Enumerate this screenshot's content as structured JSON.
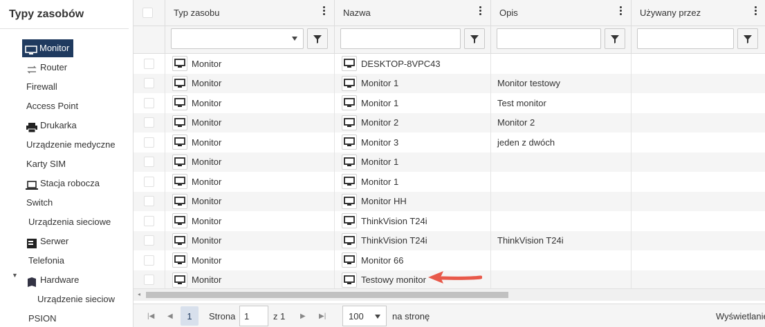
{
  "sidebar": {
    "title": "Typy zasobów",
    "items": [
      {
        "label": "Monitor",
        "icon": "monitor-icon"
      },
      {
        "label": "Router",
        "icon": "router-icon"
      },
      {
        "label": "Firewall",
        "icon": ""
      },
      {
        "label": "Access Point",
        "icon": ""
      },
      {
        "label": "Drukarka",
        "icon": "printer-icon"
      },
      {
        "label": "Urządzenie medyczne",
        "icon": ""
      },
      {
        "label": "Karty SIM",
        "icon": ""
      },
      {
        "label": "Stacja robocza",
        "icon": "laptop-icon"
      },
      {
        "label": "Switch",
        "icon": ""
      },
      {
        "label": "Urządzenia sieciowe",
        "icon": ""
      },
      {
        "label": "Serwer",
        "icon": "server-icon"
      },
      {
        "label": "Telefonia",
        "icon": ""
      },
      {
        "label": "Hardware",
        "icon": "book-icon"
      },
      {
        "label": "Urządzenie sieciow",
        "icon": ""
      },
      {
        "label": "PSION",
        "icon": ""
      }
    ]
  },
  "grid": {
    "columns": [
      "Typ zasobu",
      "Nazwa",
      "Opis",
      "Używany przez"
    ],
    "rows": [
      {
        "type": "Monitor",
        "name": "DESKTOP-8VPC43",
        "desc": ""
      },
      {
        "type": "Monitor",
        "name": "Monitor 1",
        "desc": "Monitor testowy"
      },
      {
        "type": "Monitor",
        "name": "Monitor 1",
        "desc": "Test monitor"
      },
      {
        "type": "Monitor",
        "name": "Monitor 2",
        "desc": "Monitor 2"
      },
      {
        "type": "Monitor",
        "name": "Monitor 3",
        "desc": "jeden z dwóch"
      },
      {
        "type": "Monitor",
        "name": "Monitor 1",
        "desc": ""
      },
      {
        "type": "Monitor",
        "name": "Monitor 1",
        "desc": ""
      },
      {
        "type": "Monitor",
        "name": "Monitor HH",
        "desc": ""
      },
      {
        "type": "Monitor",
        "name": "ThinkVision T24i",
        "desc": ""
      },
      {
        "type": "Monitor",
        "name": "ThinkVision T24i",
        "desc": "ThinkVision T24i"
      },
      {
        "type": "Monitor",
        "name": "Monitor 66",
        "desc": ""
      },
      {
        "type": "Monitor",
        "name": "Testowy monitor",
        "desc": ""
      }
    ]
  },
  "pager": {
    "current_page": "1",
    "page_label": "Strona",
    "page_input": "1",
    "of_label": "z 1",
    "page_size": "100",
    "per_page_label": "na stronę",
    "display_label": "Wyświetlanie"
  },
  "colors": {
    "selected_bg": "#1f3a5f",
    "arrow": "#e8594a",
    "alt_row": "#f5f5f5"
  }
}
